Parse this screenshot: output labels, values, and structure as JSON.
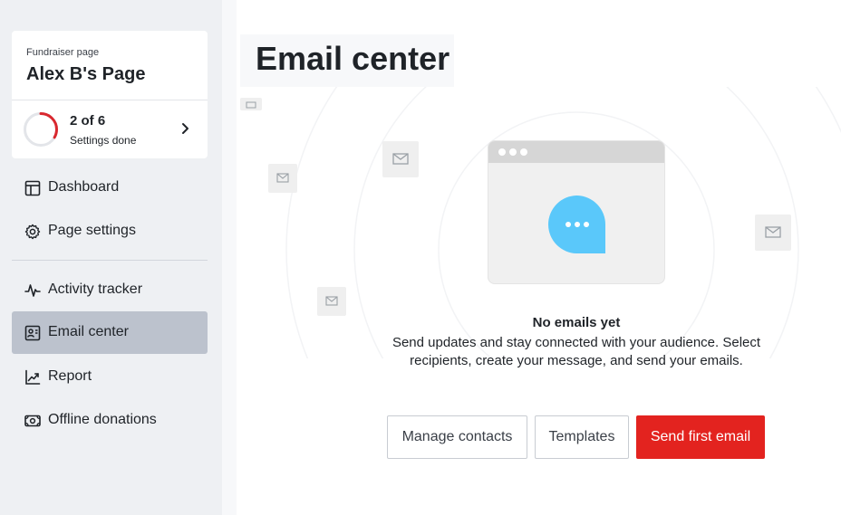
{
  "sidebar": {
    "page_card": {
      "label": "Fundraiser page",
      "name": "Alex B's Page"
    },
    "progress": {
      "count": "2 of 6",
      "subtitle": "Settings done",
      "completed": 2,
      "total": 6,
      "ring_color": "#d9282f"
    },
    "items": [
      {
        "label": "Dashboard",
        "icon": "dashboard-icon"
      },
      {
        "label": "Page settings",
        "icon": "gear-icon"
      },
      {
        "label": "Activity tracker",
        "icon": "activity-icon"
      },
      {
        "label": "Email center",
        "icon": "contact-card-icon",
        "active": true
      },
      {
        "label": "Report",
        "icon": "chart-icon"
      },
      {
        "label": "Offline donations",
        "icon": "cash-icon"
      }
    ]
  },
  "main": {
    "title": "Email center",
    "empty_state": {
      "title": "No emails yet",
      "description": "Send updates and stay connected with your audience. Select recipients, create your message, and send your emails."
    },
    "buttons": {
      "manage_contacts": "Manage contacts",
      "templates": "Templates",
      "send_first_email": "Send first email"
    }
  },
  "colors": {
    "primary": "#e3231f",
    "active_nav": "#bcc2cd",
    "chat_bubble": "#5ac8fa"
  }
}
